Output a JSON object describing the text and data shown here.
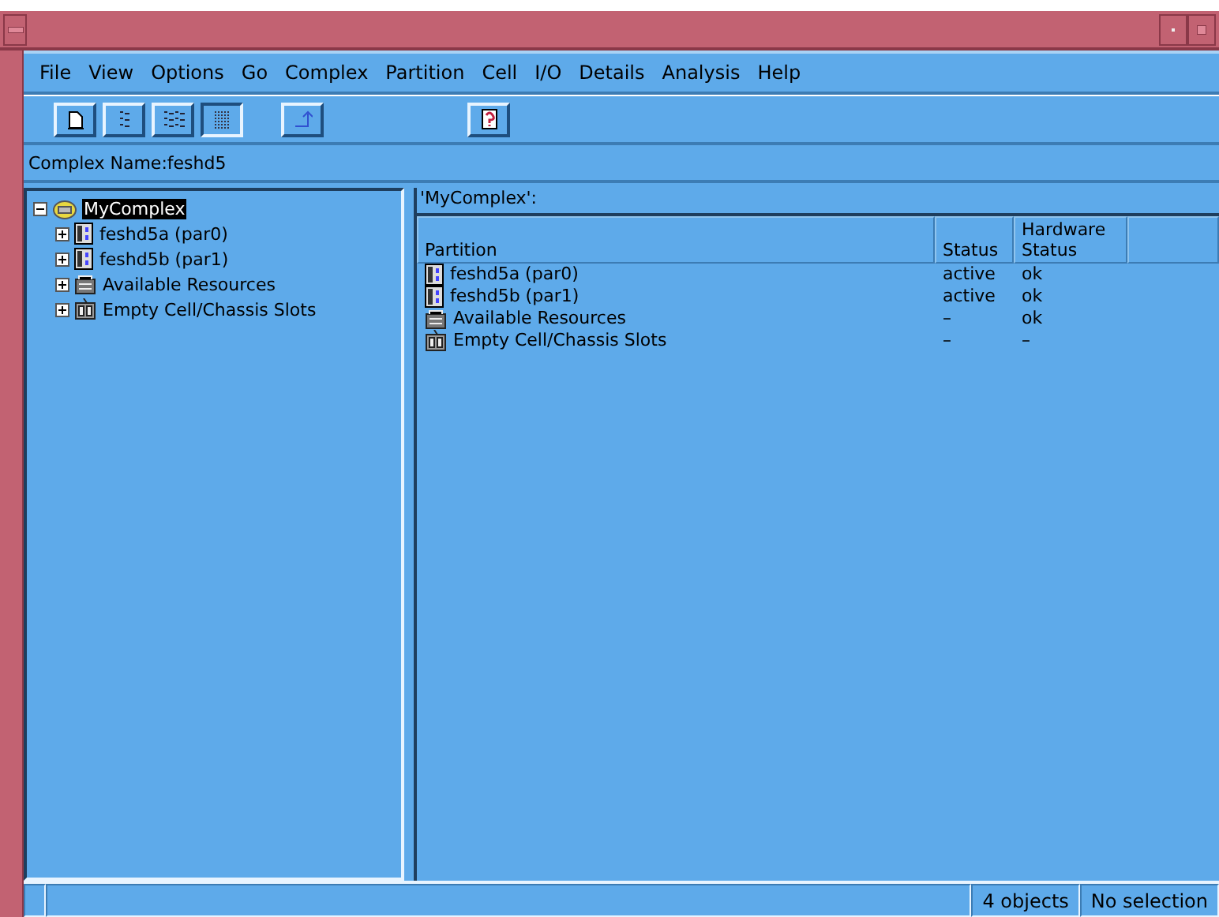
{
  "menu": [
    "File",
    "View",
    "Options",
    "Go",
    "Complex",
    "Partition",
    "Cell",
    "I/O",
    "Details",
    "Analysis",
    "Help"
  ],
  "toolbar": [
    {
      "kind": "page",
      "selected": false
    },
    {
      "kind": "list",
      "selected": false
    },
    {
      "kind": "columns",
      "selected": false
    },
    {
      "kind": "table",
      "selected": true
    },
    {
      "kind": "arrow",
      "selected": false
    },
    {
      "kind": "help",
      "selected": false
    }
  ],
  "complex_name": "Complex Name:feshd5",
  "tree": {
    "label": "MyComplex",
    "selected": true,
    "expanded": true,
    "children": [
      {
        "label": "feshd5a (par0)",
        "kind": "partition",
        "expanded": false
      },
      {
        "label": "feshd5b (par1)",
        "kind": "partition",
        "expanded": false
      },
      {
        "label": "Available Resources",
        "kind": "resources",
        "expanded": false
      },
      {
        "label": "Empty Cell/Chassis Slots",
        "kind": "slots",
        "expanded": false
      }
    ]
  },
  "table": {
    "title": "'MyComplex':",
    "columns": [
      "Partition",
      "Status",
      "Hardware Status"
    ],
    "rows": [
      {
        "kind": "partition",
        "cells": [
          "feshd5a (par0)",
          "active",
          "ok"
        ]
      },
      {
        "kind": "partition",
        "cells": [
          "feshd5b (par1)",
          "active",
          "ok"
        ]
      },
      {
        "kind": "resources",
        "cells": [
          "Available Resources",
          "–",
          "ok"
        ]
      },
      {
        "kind": "slots",
        "cells": [
          "Empty Cell/Chassis Slots",
          "–",
          "–"
        ]
      }
    ]
  },
  "status_bar": [
    "4 objects",
    "No selection"
  ]
}
